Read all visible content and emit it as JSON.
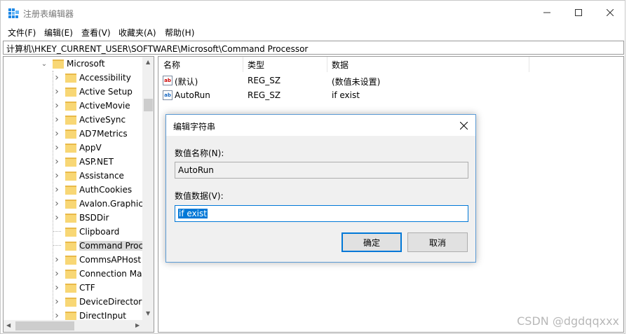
{
  "window": {
    "title": "注册表编辑器"
  },
  "menu": [
    "文件(F)",
    "编辑(E)",
    "查看(V)",
    "收藏夹(A)",
    "帮助(H)"
  ],
  "address": "计算机\\HKEY_CURRENT_USER\\SOFTWARE\\Microsoft\\Command Processor",
  "tree": {
    "parent": "Microsoft",
    "children": [
      "Accessibility",
      "Active Setup",
      "ActiveMovie",
      "ActiveSync",
      "AD7Metrics",
      "AppV",
      "ASP.NET",
      "Assistance",
      "AuthCookies",
      "Avalon.Graphics",
      "BSDDir",
      "Clipboard",
      "Command Proc",
      "CommsAPHost",
      "Connection Mar",
      "CTF",
      "DeviceDirectory",
      "DirectInput"
    ],
    "selected_index": 12
  },
  "list": {
    "headers": [
      "名称",
      "类型",
      "数据"
    ],
    "rows": [
      {
        "icon": "string-value-icon",
        "name": "(默认)",
        "type": "REG_SZ",
        "data": "(数值未设置)"
      },
      {
        "icon": "string-value-icon",
        "name": "AutoRun",
        "type": "REG_SZ",
        "data": "if exist"
      }
    ]
  },
  "dialog": {
    "title": "编辑字符串",
    "name_label": "数值名称(N):",
    "name_value": "AutoRun",
    "data_label": "数值数据(V):",
    "data_value": "if exist",
    "ok": "确定",
    "cancel": "取消"
  },
  "watermark": "CSDN @dgdqqxxx"
}
